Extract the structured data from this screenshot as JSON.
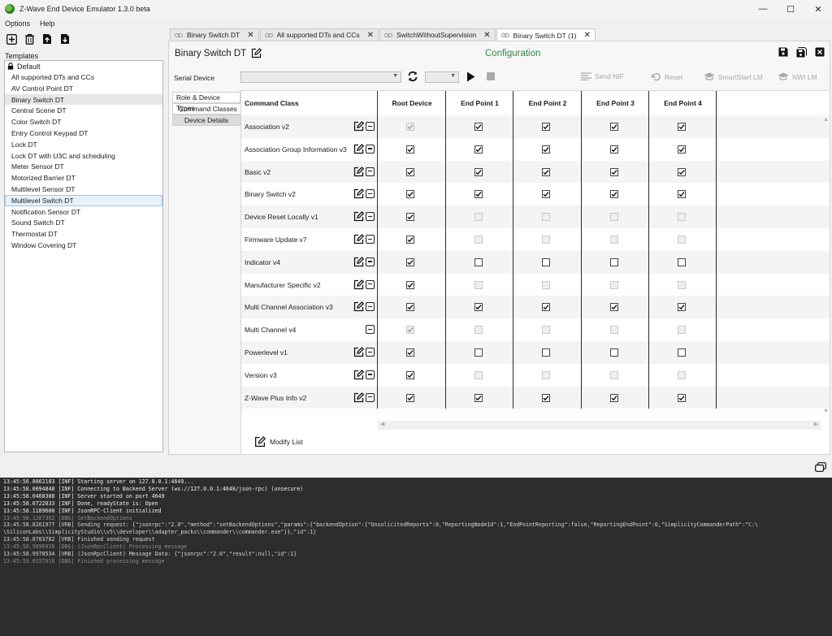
{
  "window": {
    "title": "Z-Wave End Device Emulator 1.3.0 beta",
    "minimize": "—",
    "maximize": "☐",
    "close": "✕"
  },
  "menu": [
    "Options",
    "Help"
  ],
  "templates": {
    "label": "Templates",
    "group": "Default",
    "items": [
      "All supported DTs and CCs",
      "AV Control Point DT",
      "Binary Switch DT",
      "Central Scene DT",
      "Color Switch DT",
      "Entry Control Keypad DT",
      "Lock DT",
      "Lock DT with U3C and scheduling",
      "Meter Sensor DT",
      "Motorized Barrier DT",
      "Multilevel Sensor DT",
      "Multilevel Switch DT",
      "Notification Sensor DT",
      "Sound Switch DT",
      "Thermostat DT",
      "Window Covering DT"
    ]
  },
  "tabs": [
    {
      "label": "Binary Switch DT"
    },
    {
      "label": "All supported DTs and CCs"
    },
    {
      "label": "SwitchWithoutSupervision"
    },
    {
      "label": "Binary Switch DT (1)"
    }
  ],
  "main": {
    "title": "Binary Switch DT",
    "config_title": "Configuration",
    "serial_label": "Serial Device",
    "send_nif": "Send NIF",
    "reset": "Reset",
    "smartstart": "SmartStart LM",
    "nwi": "NWI LM",
    "side_tabs": [
      "Role & Device Types",
      "Command Classes",
      "Device Details"
    ],
    "modify_list": "Modify List"
  },
  "grid": {
    "headers": [
      "Command Class",
      "Root Device",
      "End Point 1",
      "End Point 2",
      "End Point 3",
      "End Point 4"
    ],
    "rows": [
      {
        "name": "Association v2",
        "edit": true,
        "cells": [
          "cd",
          "c",
          "c",
          "c",
          "c"
        ]
      },
      {
        "name": "Association Group Information v3",
        "edit": true,
        "cells": [
          "c",
          "c",
          "c",
          "c",
          "c"
        ]
      },
      {
        "name": "Basic v2",
        "edit": true,
        "cells": [
          "c",
          "c",
          "c",
          "c",
          "c"
        ]
      },
      {
        "name": "Binary Switch v2",
        "edit": true,
        "cells": [
          "c",
          "c",
          "c",
          "c",
          "c"
        ]
      },
      {
        "name": "Device Reset Locally v1",
        "edit": true,
        "cells": [
          "c",
          "d",
          "d",
          "d",
          "d"
        ]
      },
      {
        "name": "Firmware Update v7",
        "edit": true,
        "cells": [
          "c",
          "d",
          "d",
          "d",
          "d"
        ]
      },
      {
        "name": "Indicator v4",
        "edit": true,
        "cells": [
          "c",
          "u",
          "u",
          "u",
          "u"
        ]
      },
      {
        "name": "Manufacturer Specific v2",
        "edit": true,
        "cells": [
          "c",
          "d",
          "d",
          "d",
          "d"
        ]
      },
      {
        "name": "Multi Channel Association v3",
        "edit": true,
        "cells": [
          "c",
          "c",
          "c",
          "c",
          "c"
        ]
      },
      {
        "name": "Multi Channel v4",
        "edit": false,
        "cells": [
          "cd",
          "d",
          "d",
          "d",
          "d"
        ]
      },
      {
        "name": "Powerlevel v1",
        "edit": true,
        "cells": [
          "c",
          "u",
          "u",
          "u",
          "u"
        ]
      },
      {
        "name": "Version v3",
        "edit": true,
        "cells": [
          "c",
          "d",
          "d",
          "d",
          "d"
        ]
      },
      {
        "name": "Z-Wave Plus Info v2",
        "edit": true,
        "cells": [
          "c",
          "c",
          "c",
          "c",
          "c"
        ]
      }
    ]
  },
  "console": [
    {
      "level": "inf",
      "text": "13:45:56.8862103 [INF] Starting server on 127.0.0.1:4649..."
    },
    {
      "level": "inf",
      "text": "13:45:58.0094840 [INF] Connecting to Backend Server (ws://127.0.0.1:4648/json-rpc) (unsecure)"
    },
    {
      "level": "inf",
      "text": "13:45:58.0468388 [INF] Server started on port 4649"
    },
    {
      "level": "inf",
      "text": "13:45:58.0722833 [INF] Done, readyState is: Open"
    },
    {
      "level": "inf",
      "text": "13:45:58.1189600 [INF] JsonRPC-Client initialized"
    },
    {
      "level": "dbg",
      "text": "13:45:58.1207302 [DBG] SetBackendOptions"
    },
    {
      "level": "vrb",
      "text": "13:45:58.8261977 [VRB] Sending request: {\"jsonrpc\":\"2.0\",\"method\":\"setBackendOptions\",\"params\":{\"backendOption\":{\"UnsolicitedReports\":0,\"ReportingNodeId\":1,\"EndPointReporting\":false,\"ReportingEndPoint\":0,\"SimplicityCommanderPath\":\"C:\\"
    },
    {
      "level": "vrb",
      "text": "\\SiliconLabs\\\\SimplicityStudio\\\\v5\\\\developer\\\\adapter_packs\\\\commander\\\\commander.exe\"}},\"id\":1}"
    },
    {
      "level": "vrb",
      "text": "13:45:58.8703782 [VRB] Finished sending request"
    },
    {
      "level": "dbg",
      "text": "13:45:58.9896938 [DBG] (JsonRpcClient) Processing message"
    },
    {
      "level": "vrb",
      "text": "13:45:58.9978534 [VRB] (JsonRpcClient) Message Data: {\"jsonrpc\":\"2.0\",\"result\":null,\"id\":1}"
    },
    {
      "level": "dbg",
      "text": "13:45:59.0157016 [DBG] Finished processing message"
    }
  ]
}
